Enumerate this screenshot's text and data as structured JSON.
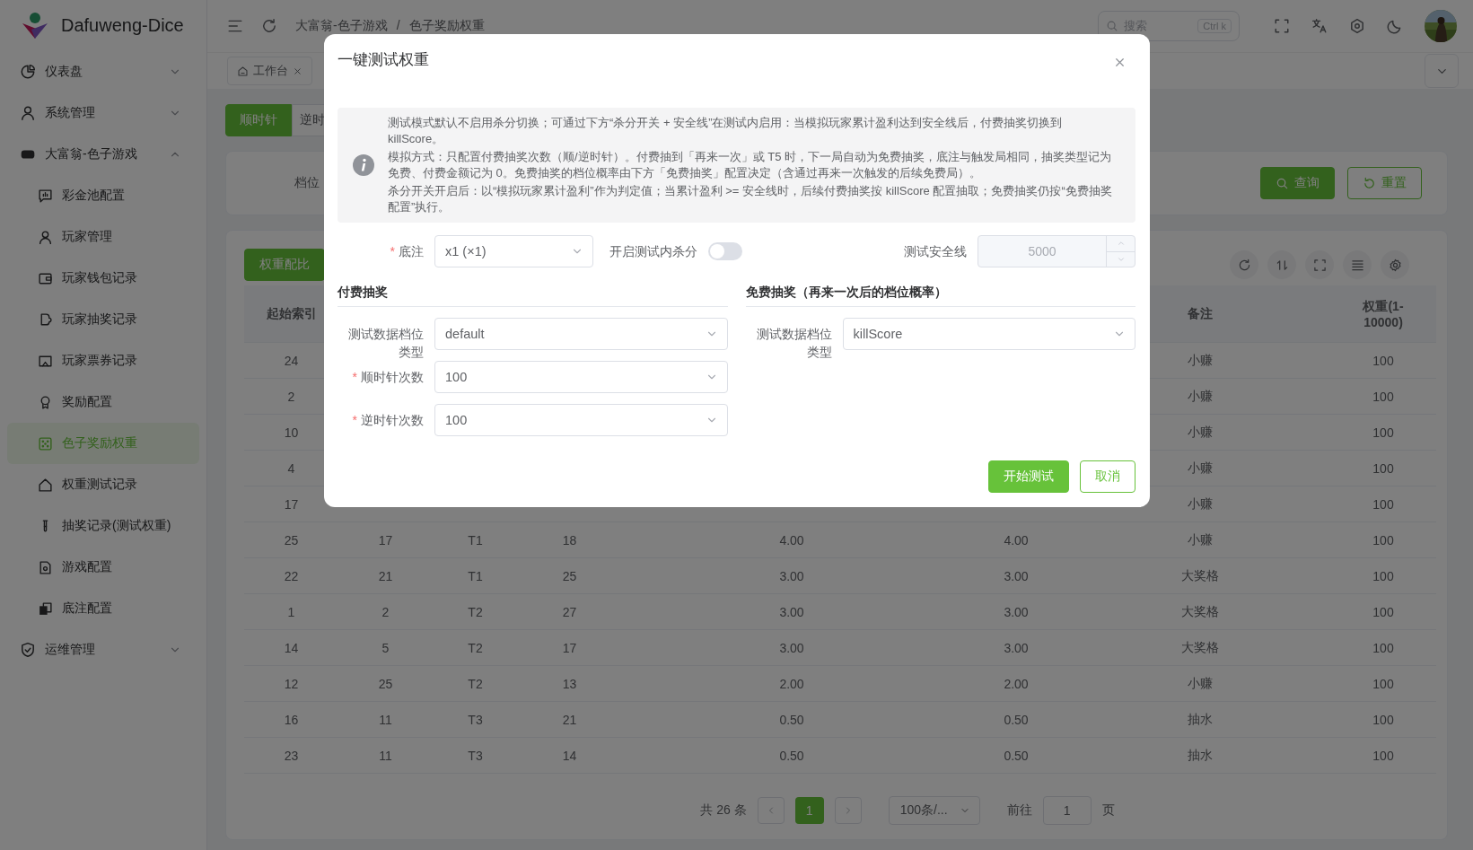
{
  "app": {
    "name": "Dafuweng-Dice"
  },
  "sidebar": {
    "items": [
      {
        "label": "仪表盘",
        "expanded": false
      },
      {
        "label": "系统管理",
        "expanded": false
      },
      {
        "label": "大富翁-色子游戏",
        "expanded": true,
        "children": [
          {
            "label": "彩金池配置",
            "selected": false
          },
          {
            "label": "玩家管理",
            "selected": false
          },
          {
            "label": "玩家钱包记录",
            "selected": false
          },
          {
            "label": "玩家抽奖记录",
            "selected": false
          },
          {
            "label": "玩家票券记录",
            "selected": false
          },
          {
            "label": "奖励配置",
            "selected": false
          },
          {
            "label": "色子奖励权重",
            "selected": true
          },
          {
            "label": "权重测试记录",
            "selected": false
          },
          {
            "label": "抽奖记录(测试权重)",
            "selected": false
          },
          {
            "label": "游戏配置",
            "selected": false
          },
          {
            "label": "底注配置",
            "selected": false
          }
        ]
      },
      {
        "label": "运维管理",
        "expanded": false
      }
    ]
  },
  "header": {
    "breadcrumb": [
      "大富翁-色子游戏",
      "色子奖励权重"
    ],
    "separator": "/",
    "search": {
      "placeholder": "搜索",
      "shortcut": "Ctrl k"
    }
  },
  "tabs": [
    {
      "label": "工作台",
      "closable": true
    }
  ],
  "direction_buttons": [
    {
      "label": "顺时针",
      "selected": true
    },
    {
      "label": "逆时",
      "selected": false
    }
  ],
  "filter": {
    "label": "档位",
    "buttons": [
      {
        "label": "查询",
        "kind": "primary"
      },
      {
        "label": "重置",
        "kind": "outline"
      }
    ]
  },
  "table": {
    "action": "权重配比",
    "columns": [
      "起始索引",
      null,
      null,
      null,
      null,
      null,
      "备注",
      "权重(1-10000)"
    ],
    "rows": [
      [
        "24",
        null,
        null,
        null,
        null,
        null,
        "小赚",
        "100"
      ],
      [
        "2",
        null,
        null,
        null,
        null,
        null,
        "小赚",
        "100"
      ],
      [
        "10",
        null,
        null,
        null,
        null,
        null,
        "小赚",
        "100"
      ],
      [
        "4",
        null,
        null,
        null,
        null,
        null,
        "小赚",
        "100"
      ],
      [
        "17",
        null,
        null,
        null,
        null,
        null,
        "小赚",
        "100"
      ],
      [
        "25",
        "17",
        "T1",
        "18",
        "4.00",
        "4.00",
        "小赚",
        "100"
      ],
      [
        "22",
        "21",
        "T1",
        "25",
        "3.00",
        "3.00",
        "大奖格",
        "100"
      ],
      [
        "1",
        "2",
        "T2",
        "27",
        "3.00",
        "3.00",
        "大奖格",
        "100"
      ],
      [
        "14",
        "5",
        "T2",
        "17",
        "3.00",
        "3.00",
        "大奖格",
        "100"
      ],
      [
        "12",
        "25",
        "T2",
        "13",
        "2.00",
        "2.00",
        "小赚",
        "100"
      ],
      [
        "16",
        "11",
        "T3",
        "21",
        "0.50",
        "0.50",
        "抽水",
        "100"
      ],
      [
        "23",
        "11",
        "T3",
        "14",
        "0.50",
        "0.50",
        "抽水",
        "100"
      ]
    ]
  },
  "pagination": {
    "total": "共 26 条",
    "pages": [
      {
        "label": "1",
        "selected": true
      }
    ],
    "page_size": "100条/...",
    "goto_label": "前往",
    "goto_value": "1",
    "page_suffix": "页"
  },
  "dialog": {
    "title": "一键测试权重",
    "notice": [
      "测试模式默认不启用杀分切换；可通过下方“杀分开关 + 安全线”在测试内启用：当模拟玩家累计盈利达到安全线后，付费抽奖切换到 killScore。",
      "模拟方式：只配置付费抽奖次数（顺/逆时针）。付费抽到「再来一次」或 T5 时，下一局自动为免费抽奖，底注与触发局相同，抽奖类型记为免费、付费金额记为 0。免费抽奖的档位概率由下方「免费抽奖」配置决定（含通过再来一次触发的后续免费局）。",
      "杀分开关开启后：以“模拟玩家累计盈利”作为判定值；当累计盈利 >= 安全线时，后续付费抽奖按 killScore 配置抽取；免费抽奖仍按“免费抽奖配置”执行。"
    ],
    "bet": {
      "label": "底注",
      "marker": "*",
      "value": "x1 (×1)"
    },
    "kill_switch": {
      "label": "开启测试内杀分",
      "on": false
    },
    "safety_line": {
      "label": "测试安全线",
      "value": "5000",
      "disabled": true
    },
    "paid": {
      "title": "付费抽奖",
      "fields": [
        {
          "label": "测试数据档位类型",
          "value": "default"
        },
        {
          "label": "顺时针次数",
          "marker": "*",
          "value": "100"
        },
        {
          "label": "逆时针次数",
          "marker": "*",
          "value": "100"
        }
      ]
    },
    "free": {
      "title": "免费抽奖（再来一次后的档位概率）",
      "fields": [
        {
          "label": "测试数据档位类型",
          "value": "killScore"
        }
      ]
    },
    "buttons": [
      {
        "label": "开始测试",
        "kind": "primary"
      },
      {
        "label": "取消",
        "kind": "outline"
      }
    ]
  }
}
